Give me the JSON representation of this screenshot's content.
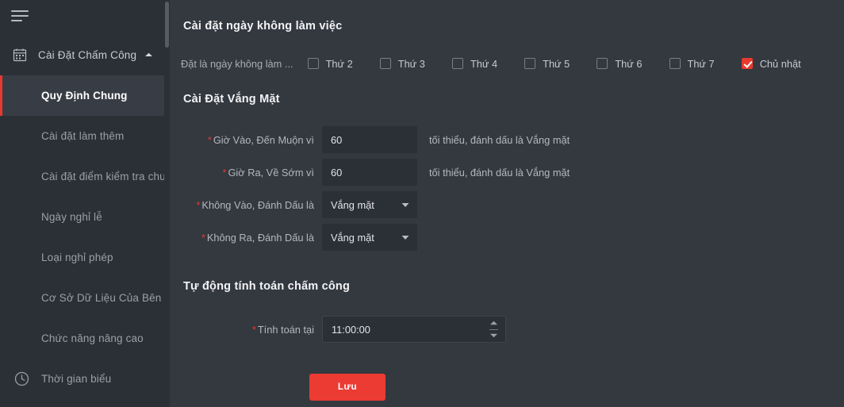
{
  "sidebar": {
    "menu_icon": "hamburger-icon",
    "group": {
      "icon": "calendar-icon",
      "label": "Cài Đặt Chấm Công",
      "chevron": "chevron-up-icon"
    },
    "items": [
      {
        "label": "Quy Định Chung",
        "active": true,
        "icon": null
      },
      {
        "label": "Cài đặt làm thêm",
        "active": false,
        "icon": null
      },
      {
        "label": "Cài đặt điểm kiểm tra chu...",
        "active": false,
        "icon": null
      },
      {
        "label": "Ngày nghỉ lễ",
        "active": false,
        "icon": null
      },
      {
        "label": "Loại nghỉ phép",
        "active": false,
        "icon": null
      },
      {
        "label": "Cơ Sở Dữ Liệu Của Bên Th...",
        "active": false,
        "icon": null
      },
      {
        "label": "Chức năng nâng cao",
        "active": false,
        "icon": null
      },
      {
        "label": "Thời gian biểu",
        "active": false,
        "icon": "clock-icon"
      }
    ]
  },
  "main": {
    "section_nonworking": {
      "title": "Cài đặt ngày không làm việc",
      "lead_label": "Đặt là ngày không làm ...",
      "days": [
        {
          "label": "Thứ 2",
          "checked": false
        },
        {
          "label": "Thứ 3",
          "checked": false
        },
        {
          "label": "Thứ 4",
          "checked": false
        },
        {
          "label": "Thứ 5",
          "checked": false
        },
        {
          "label": "Thứ 6",
          "checked": false
        },
        {
          "label": "Thứ 7",
          "checked": false
        },
        {
          "label": "Chủ nhật",
          "checked": true
        }
      ]
    },
    "section_absence": {
      "title": "Cài Đặt Vắng Mặt",
      "row_late": {
        "label": "Giờ Vào, Đến Muộn vì",
        "value": "60",
        "suffix": "tối thiểu, đánh dấu là Vắng mặt"
      },
      "row_early": {
        "label": "Giờ Ra, Về Sớm vì",
        "value": "60",
        "suffix": "tối thiểu, đánh dấu là Vắng mặt"
      },
      "row_no_in": {
        "label": "Không Vào, Đánh Dấu là",
        "value": "Vắng mặt"
      },
      "row_no_out": {
        "label": "Không Ra, Đánh Dấu là",
        "value": "Vắng mặt"
      }
    },
    "section_auto": {
      "title": "Tự động tính toán chấm công",
      "row_time": {
        "label": "Tính toán tại",
        "value": "11:00:00"
      }
    },
    "save_label": "Lưu"
  },
  "colors": {
    "accent_red": "#e8392f",
    "sidebar_bg": "#2b2f36",
    "main_bg": "#34383f",
    "active_item_bg": "#383c44",
    "input_bg": "#2b2f36"
  }
}
